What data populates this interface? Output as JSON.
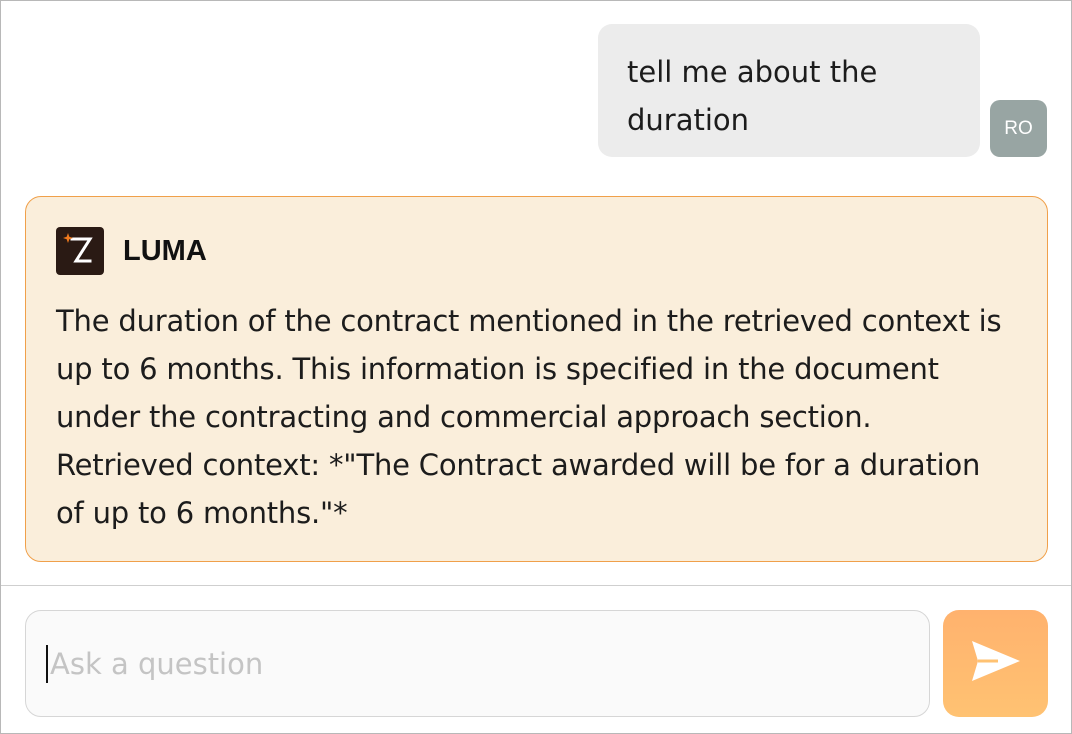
{
  "conversation": {
    "user_message": {
      "line1": "tell me about the",
      "line2": "duration",
      "avatar_initials": "RO"
    },
    "assistant_message": {
      "name": "LUMA",
      "logo_icon": "luma-logo-icon",
      "lines": [
        "The duration of the contract mentioned in the retrieved context is",
        "up to 6 months. This information is specified in the document",
        "under the contracting and commercial approach section.",
        "Retrieved context: *\"The Contract awarded will be for a duration",
        "of up to 6 months.\"*"
      ]
    }
  },
  "composer": {
    "placeholder": "Ask a question",
    "value": "",
    "send_icon": "send-icon"
  },
  "colors": {
    "accent": "#ffb26e",
    "assistant_bg": "#faeedb",
    "assistant_border": "#f0a04a",
    "user_bubble_bg": "#ececec",
    "avatar_bg": "#98a5a3"
  }
}
